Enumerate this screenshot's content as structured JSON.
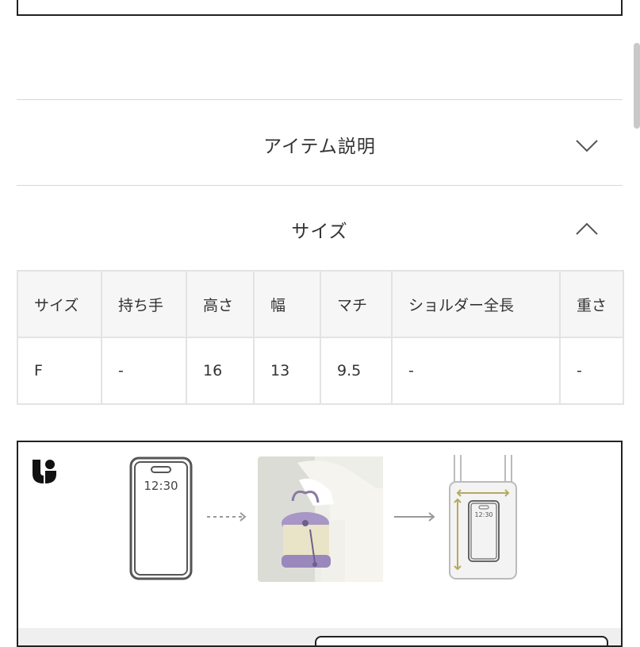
{
  "accordion": {
    "item_description": {
      "label": "アイテム説明",
      "state": "collapsed",
      "icon": "chevron-down-icon"
    },
    "size": {
      "label": "サイズ",
      "state": "expanded",
      "icon": "chevron-up-icon"
    }
  },
  "size_table": {
    "headers": [
      "サイズ",
      "持ち手",
      "高さ",
      "幅",
      "マチ",
      "ショルダー全長",
      "重さ"
    ],
    "rows": [
      [
        "F",
        "-",
        "16",
        "13",
        "9.5",
        "-",
        "-"
      ]
    ]
  },
  "guide": {
    "logo_icon": "brand-logo-icon",
    "phone_time": "12:30",
    "phone_time_small": "12:30",
    "icons": [
      "phone-outline-icon",
      "dashed-arrow-right-icon",
      "bag-photo",
      "arrow-right-icon",
      "bag-with-phone-icon"
    ]
  },
  "colors": {
    "border_dark": "#222222",
    "divider": "#d6d6d6",
    "table_header_bg": "#f6f6f6",
    "measure_accent": "#b6a95e"
  }
}
